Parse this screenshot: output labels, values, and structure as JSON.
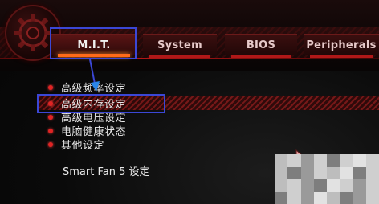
{
  "tabs": [
    {
      "label": "M.I.T.",
      "active": true
    },
    {
      "label": "System",
      "active": false
    },
    {
      "label": "BIOS",
      "active": false
    },
    {
      "label": "Peripherals",
      "active": false
    }
  ],
  "menu": {
    "items": [
      {
        "label": "高级频率设定",
        "selected": false
      },
      {
        "label": "高级内存设定",
        "selected": true
      },
      {
        "label": "高级电压设定",
        "selected": false
      },
      {
        "label": "电脑健康状态",
        "selected": false
      },
      {
        "label": "其他设定",
        "selected": false
      }
    ],
    "extra": "Smart Fan 5 设定"
  },
  "colors": {
    "accent_red": "#e02424",
    "annotation_blue": "#3b47d6",
    "active_tab_glow": "#ff6a1a"
  },
  "icons": {
    "logo": "gear-logo-icon",
    "bullet": "bullet-dot-icon",
    "cursor": "mouse-cursor-icon"
  }
}
